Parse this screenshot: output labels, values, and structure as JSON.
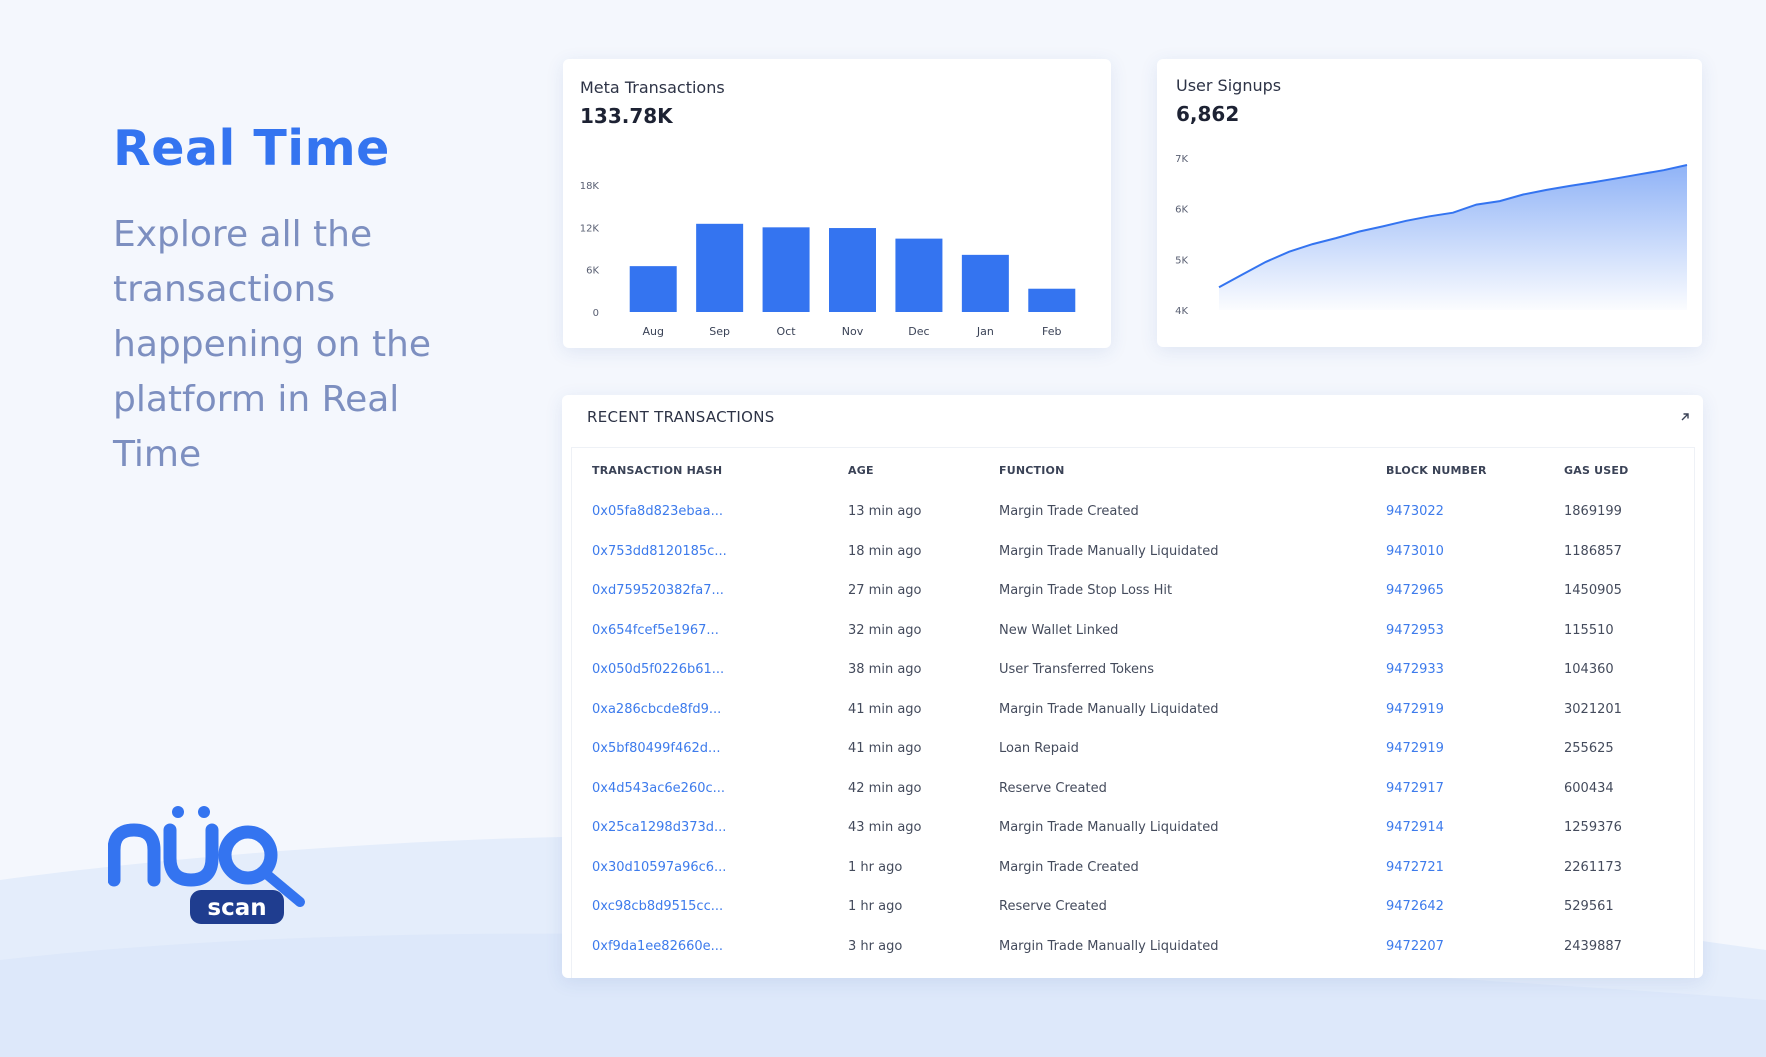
{
  "hero": {
    "title": "Real Time",
    "description": "Explore all the transactions happening on the platform in Real Time"
  },
  "brand": {
    "logo_letters": "nuq",
    "logo_tag": "scan",
    "color_primary": "#3474f0",
    "color_dark": "#1f3d8f"
  },
  "meta_card": {
    "label": "Meta Transactions",
    "value": "133.78K"
  },
  "signup_card": {
    "label": "User Signups",
    "value": "6,862"
  },
  "chart_data": [
    {
      "type": "bar",
      "categories": [
        "Aug",
        "Sep",
        "Oct",
        "Nov",
        "Dec",
        "Jan",
        "Feb"
      ],
      "values": [
        6500,
        12500,
        12000,
        11900,
        10400,
        8100,
        3300
      ],
      "yticks": [
        "0",
        "6K",
        "12K",
        "18K"
      ],
      "ylim": [
        0,
        18000
      ],
      "color": "#3474f0",
      "grid": false
    },
    {
      "type": "area",
      "x": [
        0,
        1,
        2,
        3,
        4,
        5,
        6,
        7,
        8,
        9,
        10,
        11,
        12,
        13,
        14,
        15,
        16,
        17,
        18,
        19,
        20
      ],
      "values": [
        4450,
        4700,
        4950,
        5150,
        5300,
        5420,
        5550,
        5650,
        5760,
        5850,
        5920,
        6080,
        6150,
        6280,
        6370,
        6450,
        6520,
        6600,
        6680,
        6760,
        6862
      ],
      "yticks": [
        "4K",
        "5K",
        "6K",
        "7K"
      ],
      "ylim": [
        4000,
        7000
      ],
      "color": "#3474f0",
      "grid": false
    }
  ],
  "transactions": {
    "title": "RECENT TRANSACTIONS",
    "columns": [
      "TRANSACTION HASH",
      "AGE",
      "FUNCTION",
      "BLOCK NUMBER",
      "GAS USED"
    ],
    "rows": [
      {
        "hash": "0x05fa8d823ebaa...",
        "age": "13 min ago",
        "function": "Margin Trade Created",
        "block": "9473022",
        "gas": "1869199"
      },
      {
        "hash": "0x753dd8120185c...",
        "age": "18 min ago",
        "function": "Margin Trade Manually Liquidated",
        "block": "9473010",
        "gas": "1186857"
      },
      {
        "hash": "0xd759520382fa7...",
        "age": "27 min ago",
        "function": "Margin Trade Stop Loss Hit",
        "block": "9472965",
        "gas": "1450905"
      },
      {
        "hash": "0x654fcef5e1967...",
        "age": "32 min ago",
        "function": "New Wallet Linked",
        "block": "9472953",
        "gas": "115510"
      },
      {
        "hash": "0x050d5f0226b61...",
        "age": "38 min ago",
        "function": "User Transferred Tokens",
        "block": "9472933",
        "gas": "104360"
      },
      {
        "hash": "0xa286cbcde8fd9...",
        "age": "41 min ago",
        "function": "Margin Trade Manually Liquidated",
        "block": "9472919",
        "gas": "3021201"
      },
      {
        "hash": "0x5bf80499f462d...",
        "age": "41 min ago",
        "function": "Loan Repaid",
        "block": "9472919",
        "gas": "255625"
      },
      {
        "hash": "0x4d543ac6e260c...",
        "age": "42 min ago",
        "function": "Reserve Created",
        "block": "9472917",
        "gas": "600434"
      },
      {
        "hash": "0x25ca1298d373d...",
        "age": "43 min ago",
        "function": "Margin Trade Manually Liquidated",
        "block": "9472914",
        "gas": "1259376"
      },
      {
        "hash": "0x30d10597a96c6...",
        "age": "1 hr ago",
        "function": "Margin Trade Created",
        "block": "9472721",
        "gas": "2261173"
      },
      {
        "hash": "0xc98cb8d9515cc...",
        "age": "1 hr ago",
        "function": "Reserve Created",
        "block": "9472642",
        "gas": "529561"
      },
      {
        "hash": "0xf9da1ee82660e...",
        "age": "3 hr ago",
        "function": "Margin Trade Manually Liquidated",
        "block": "9472207",
        "gas": "2439887"
      }
    ]
  }
}
